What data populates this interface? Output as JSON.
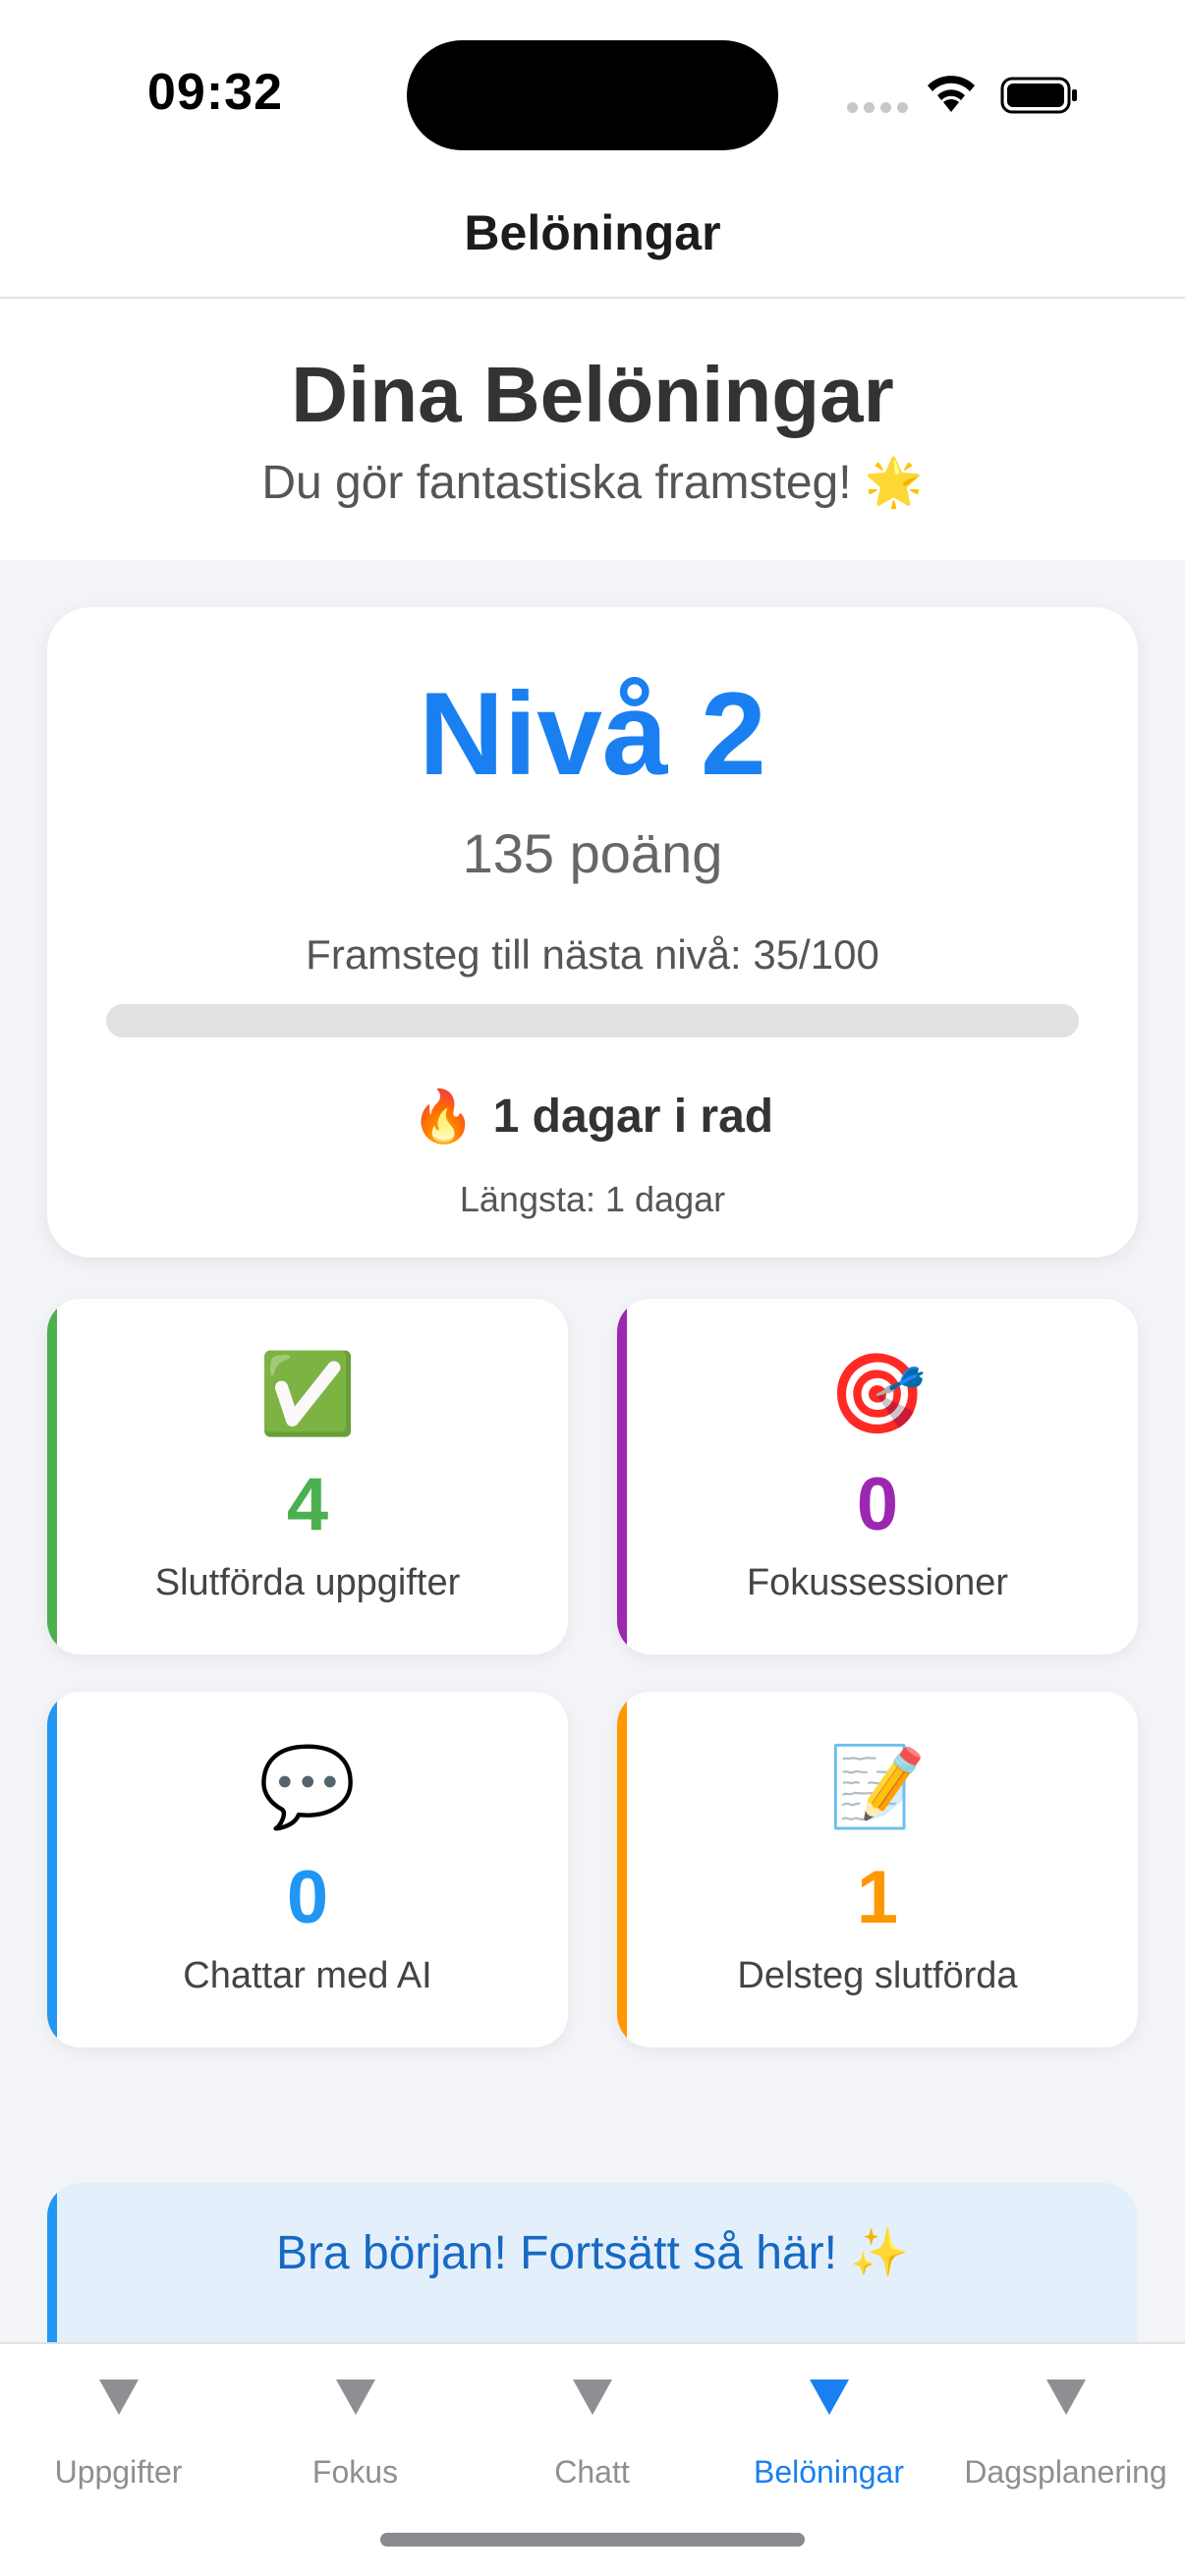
{
  "status_bar": {
    "time": "09:32"
  },
  "nav": {
    "title": "Belöningar"
  },
  "header": {
    "title": "Dina Belöningar",
    "subtitle": "Du gör fantastiska framsteg! 🌟"
  },
  "level_card": {
    "level": "Nivå 2",
    "points": "135 poäng",
    "progress_label": "Framsteg till nästa nivå: 35/100",
    "progress_fraction": 0,
    "streak_emoji": "🔥",
    "streak": "1 dagar i rad",
    "longest": "Längsta: 1 dagar"
  },
  "stats": [
    {
      "icon": "✅",
      "icon_name": "checkmark-icon",
      "value": "4",
      "label": "Slutförda uppgifter",
      "color": "#4caf50"
    },
    {
      "icon": "🎯",
      "icon_name": "target-icon",
      "value": "0",
      "label": "Fokussessioner",
      "color": "#9c27b0"
    },
    {
      "icon": "💬",
      "icon_name": "speech-bubble-icon",
      "value": "0",
      "label": "Chattar med AI",
      "color": "#2196f3"
    },
    {
      "icon": "📝",
      "icon_name": "memo-icon",
      "value": "1",
      "label": "Delsteg slutförda",
      "color": "#ff9800"
    }
  ],
  "encouragement": {
    "text": "Bra början! Fortsätt så här! ✨"
  },
  "tabs": [
    {
      "label": "Uppgifter",
      "active": false
    },
    {
      "label": "Fokus",
      "active": false
    },
    {
      "label": "Chatt",
      "active": false
    },
    {
      "label": "Belöningar",
      "active": true
    },
    {
      "label": "Dagsplanering",
      "active": false
    }
  ],
  "colors": {
    "accent": "#1a7ff0",
    "inactive": "#8e8e93"
  }
}
